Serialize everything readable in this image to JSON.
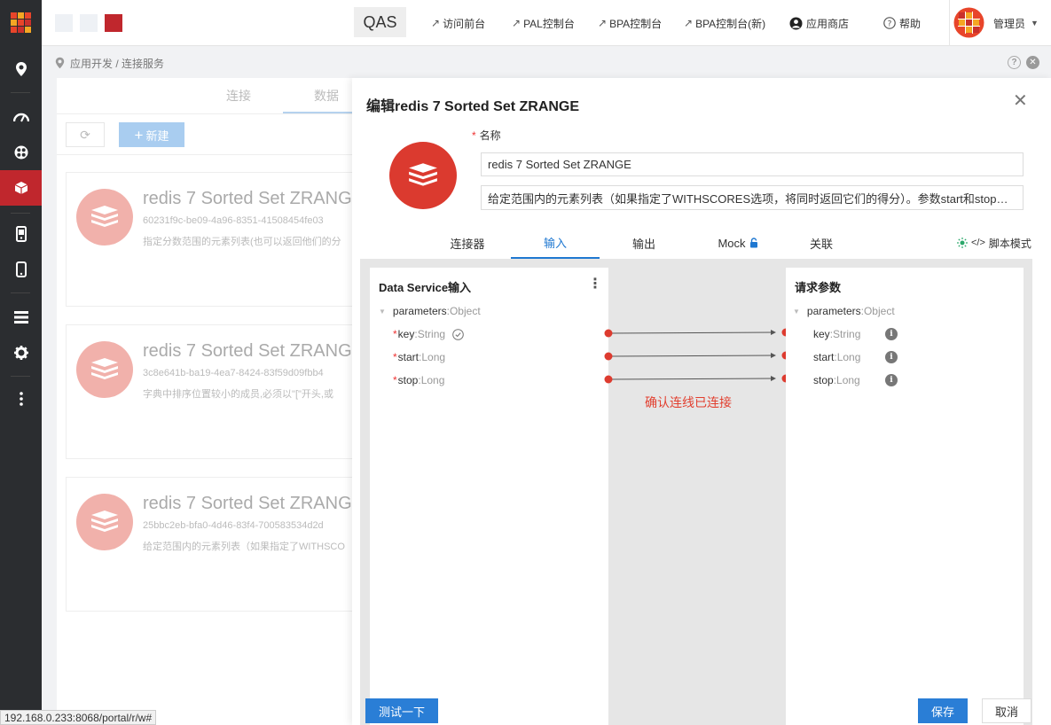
{
  "header": {
    "env": "QAS",
    "nav": [
      {
        "label": "访问前台"
      },
      {
        "label": "PAL控制台"
      },
      {
        "label": "BPA控制台"
      },
      {
        "label": "BPA控制台(新)"
      }
    ],
    "app_store": "应用商店",
    "help": "帮助",
    "user": "管理员"
  },
  "breadcrumb": {
    "path": "应用开发 / 连接服务"
  },
  "list": {
    "tabs": [
      "连接",
      "数据"
    ],
    "new_label": "新建",
    "cards": [
      {
        "title": "redis 7 Sorted Set ZRANG",
        "id": "60231f9c-be09-4a96-8351-41508454fe03",
        "desc": "指定分数范围的元素列表(也可以返回他们的分"
      },
      {
        "title": "redis 7 Sorted Set ZRANG",
        "id": "3c8e641b-ba19-4ea7-8424-83f59d09fbb4",
        "desc": "字典中排序位置较小的成员,必须以\"[\"开头,或"
      },
      {
        "title": "redis 7 Sorted Set ZRANG",
        "id": "25bbc2eb-bfa0-4d46-83f4-700583534d2d",
        "desc": "给定范围内的元素列表（如果指定了WITHSCO"
      }
    ]
  },
  "status_url": "192.168.0.233:8068/portal/r/w#",
  "modal": {
    "title": "编辑redis 7 Sorted Set ZRANGE",
    "name_label": "名称",
    "name_value": "redis 7 Sorted Set  ZRANGE",
    "desc_value": "给定范围内的元素列表（如果指定了WITHSCORES选项，将同时返回它们的得分）。参数start和stop…",
    "tabs": [
      "连接器",
      "输入",
      "输出",
      "Mock",
      "关联"
    ],
    "script_mode": "脚本模式",
    "left_title": "Data Service输入",
    "right_title": "请求参数",
    "left_fields": [
      {
        "name": "parameters",
        "type": "Object"
      },
      {
        "name": "key",
        "type": "String"
      },
      {
        "name": "start",
        "type": "Long"
      },
      {
        "name": "stop",
        "type": "Long"
      }
    ],
    "right_fields": [
      {
        "name": "parameters",
        "type": "Object"
      },
      {
        "name": "key",
        "type": "String"
      },
      {
        "name": "start",
        "type": "Long"
      },
      {
        "name": "stop",
        "type": "Long"
      }
    ],
    "sep": " : ",
    "req_mark": "*",
    "confirm": "确认连线已连接",
    "test_btn": "测试一下",
    "save_btn": "保存",
    "cancel_btn": "取消"
  },
  "colors": {
    "accent": "#2a7ed6",
    "brand_red": "#c0272d",
    "redis_red": "#db3a2f",
    "warn_text": "#e23f2f"
  },
  "icons": [
    "grid-logo-icon",
    "location-pin-icon",
    "dashboard-icon",
    "apps-icon",
    "cube-icon",
    "device-icon",
    "mobile-icon",
    "list-icon",
    "gear-icon",
    "more-icon",
    "lock-icon",
    "bulb-icon",
    "code-icon",
    "info-icon",
    "check-circle-icon",
    "refresh-icon",
    "plus-icon",
    "close-icon",
    "help-icon",
    "user-icon",
    "redis-icon"
  ]
}
